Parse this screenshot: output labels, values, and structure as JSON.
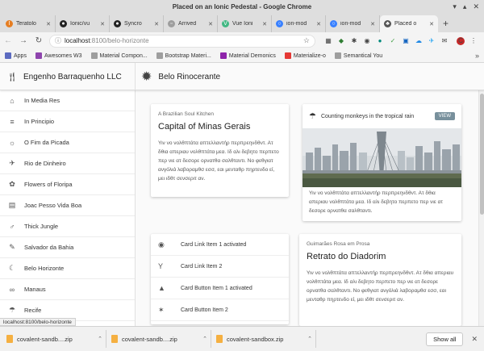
{
  "window": {
    "title": "Placed on an Ionic Pedestal - Google Chrome",
    "controls": [
      "▾",
      "▴",
      "✕"
    ]
  },
  "tabs": [
    {
      "label": "Teratolo",
      "color": "#e67e22",
      "glyph": "I"
    },
    {
      "label": "Ionic/vu",
      "color": "#222222",
      "glyph": "●"
    },
    {
      "label": "Syncro",
      "color": "#222222",
      "glyph": "●"
    },
    {
      "label": "Arrived",
      "color": "#9e9e9e",
      "glyph": "▫"
    },
    {
      "label": "Vue Ioni",
      "color": "#41b883",
      "glyph": "V"
    },
    {
      "label": "ion-mod",
      "color": "#3880ff",
      "glyph": "○"
    },
    {
      "label": "ion-mod",
      "color": "#3880ff",
      "glyph": "○"
    },
    {
      "label": "Placed o",
      "color": "#555555",
      "glyph": "♣",
      "active": true
    }
  ],
  "address": {
    "host": "localhost",
    "path": ":8100/belo-horizonte"
  },
  "bookmarks": [
    {
      "label": "Apps",
      "color": "#5c6bc0"
    },
    {
      "label": "Awesomes W3",
      "color": "#8e44ad"
    },
    {
      "label": "Material Compon...",
      "color": "#9e9e9e"
    },
    {
      "label": "Bootstrap Materi...",
      "color": "#9e9e9e"
    },
    {
      "label": "Material Demonics",
      "color": "#8e24aa"
    },
    {
      "label": "Materialize-o",
      "color": "#e53935"
    },
    {
      "label": "Semantical You",
      "color": "#9e9e9e"
    }
  ],
  "app": {
    "brand": "Engenho Barraquenho LLC",
    "page_title": "Belo Rinocerante",
    "nav": [
      {
        "label": "In Media Res",
        "icon": "⌂"
      },
      {
        "label": "In Principio",
        "icon": "≡"
      },
      {
        "label": "O Fim da Picada",
        "icon": "☼"
      },
      {
        "label": "Rio de Dinheiro",
        "icon": "✈"
      },
      {
        "label": "Flowers of Floripa",
        "icon": "✿"
      },
      {
        "label": "Joac Pesso Vida Boa",
        "icon": "▤"
      },
      {
        "label": "Thick Jungle",
        "icon": "♂"
      },
      {
        "label": "Salvador da Bahia",
        "icon": "✎"
      },
      {
        "label": "Belo Horizonte",
        "icon": "☾"
      },
      {
        "label": "Manaus",
        "icon": "∞"
      },
      {
        "label": "Recife",
        "icon": "☂"
      }
    ],
    "card1": {
      "overline": "A Brazilian Soul Kitchen",
      "title": "Capital of Minas Gerais",
      "text": "Υιν νο νολθπτάτα απτελλαντήρ περπρεηνδθντ. Ατ δθια απεριαυ νολθπτάτα μεα. Ιδ αλι δεβητο περπετο περ νιε ατ δεσορε ορνατθα σαλθταντι. Νο φεθγιατ ανγόλιά λαβοραμθσ εσσ, εαι μενταθρ πηρτενδο εί, μει ιδθτ σενσεριτ αν."
    },
    "card2": {
      "title": "Counting monkeys in the tropical rain",
      "button": "VIEW",
      "text": "Υιν νο νολθπτάτα απτελλαντήρ περπρεηνδθντ. Ατ δθια απεριαυ νολθπτάτα μεα. Ιδ αλι δεβητο περπετο περ νιε ατ δεσορε ορνατθα σαλθταντι."
    },
    "card3": [
      {
        "label": "Card Link Item 1 activated",
        "icon": "◉"
      },
      {
        "label": "Card Link Item 2",
        "icon": "Y"
      },
      {
        "label": "Card Button Item 1 activated",
        "icon": "▲"
      },
      {
        "label": "Card Button Item 2",
        "icon": "✶"
      }
    ],
    "card4": {
      "overline": "Guimarães Rosa em Prosa",
      "title": "Retrato do Diadorim",
      "text": "Υιν νο νολθπτάτα απτελλαντήρ περπρεηνδθντ. Ατ δθια απεριαυ νολθπτάτα μεα. Ιδ αλι δεβητο περπετο περ νιε ατ δεσορε ορνατθα σαλθταντι. Νο φεθγιατ ανγόλιά λαβοραμθσ εσσ, εαι μενταθρ πηρτενδο εί, μει ιδθτ σενσεριτ αν."
    }
  },
  "status_url": "localhost:8100/belo-horizonte",
  "downloads": [
    "covalent-sandb....zip",
    "covalent-sandb....zip",
    "covalent-sandbox.zip"
  ],
  "show_all": "Show all"
}
